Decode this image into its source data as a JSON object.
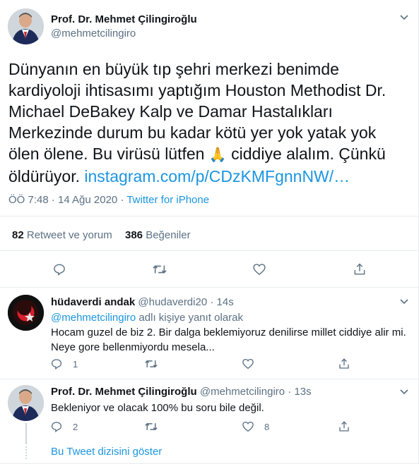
{
  "main_tweet": {
    "author_name": "Prof. Dr. Mehmet Çilingiroğlu",
    "author_handle": "@mehmetcilingiro",
    "text_lines": [
      "Dünyanın en büyük tıp şehri merkezi benimde",
      "kardiyoloji ihtisasımı yaptığım Houston Methodist Dr.",
      "Michael DeBakey Kalp ve Damar Hastalıkları",
      "Merkezinde durum bu kadar kötü yer yok yatak yok"
    ],
    "line5_before": "ölen ölene. Bu virüsü lütfen ",
    "emoji": "🙏",
    "line5_after": " ciddiye alalım. Çünkü",
    "line6_text": "öldürüyor.  ",
    "link_text": "instagram.com/p/CDzKMFgnnNW/…",
    "timestamp": "ÖÖ 7:48 · 14 Ağu 2020 · ",
    "source": "Twitter for iPhone",
    "retweets_count": "82",
    "retweets_label": " Retweet ve yorum",
    "likes_count": "386",
    "likes_label": " Beğeniler"
  },
  "reply1": {
    "author_name": "hüdaverdi andak",
    "author_handle": "@hudaverdi20",
    "time": "· 14s",
    "reply_to_handle": "@mehmetcilingiro",
    "reply_to_suffix": " adlı kişiye yanıt olarak",
    "text_lines": [
      "Hocam guzel de biz 2. Bir dalga beklemiyoruz denilirse millet ciddiye alir mi.",
      "Neye gore bellenmiyordu mesela..."
    ],
    "reply_count": "1"
  },
  "reply2": {
    "author_name": "Prof. Dr. Mehmet Çilingiroğlu",
    "author_handle": "@mehmetcilingiro",
    "time": "· 13s",
    "text": "Bekleniyor ve olacak 100% bu soru bile değil.",
    "reply_count": "2",
    "like_count": "8"
  },
  "show_thread": "Bu Tweet dizisini göster",
  "icons": {
    "reply": "reply-icon",
    "retweet": "retweet-icon",
    "like": "like-icon",
    "share": "share-icon",
    "caret": "chevron-down-icon"
  },
  "colors": {
    "link": "#1b95e0",
    "secondary_text": "#5b7083",
    "divider": "#e6ecf0"
  }
}
